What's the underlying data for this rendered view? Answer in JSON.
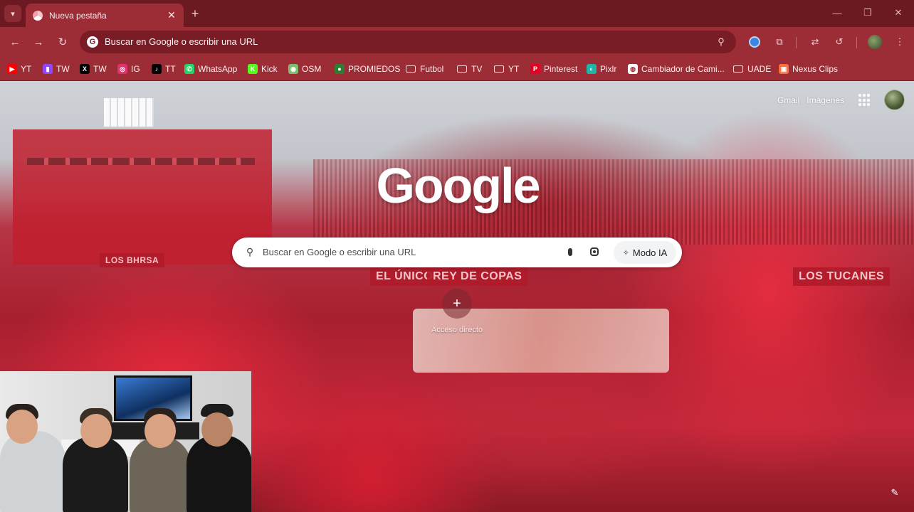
{
  "browser": {
    "tab": {
      "title": "Nueva pestaña"
    },
    "omnibox": {
      "text": "Buscar en Google o escribir una URL"
    },
    "bookmarks": [
      {
        "label": "YT",
        "icon": "youtube-icon",
        "color": "#ff0000"
      },
      {
        "label": "TW",
        "icon": "twitch-icon",
        "color": "#9146ff"
      },
      {
        "label": "TW",
        "icon": "x-icon",
        "color": "#000000"
      },
      {
        "label": "IG",
        "icon": "instagram-icon",
        "color": "#e1306c"
      },
      {
        "label": "TT",
        "icon": "tiktok-icon",
        "color": "#000000"
      },
      {
        "label": "WhatsApp",
        "icon": "whatsapp-icon",
        "color": "#25d366"
      },
      {
        "label": "Kick",
        "icon": "kick-icon",
        "color": "#53fc18"
      },
      {
        "label": "OSM",
        "icon": "osm-icon",
        "color": "#7ebc6f"
      },
      {
        "label": "PROMIEDOS",
        "icon": "promiedos-icon",
        "color": "#2e7d32"
      },
      {
        "label": "Futbol",
        "icon": "folder-icon"
      },
      {
        "label": "TV",
        "icon": "folder-icon"
      },
      {
        "label": "YT",
        "icon": "folder-icon"
      },
      {
        "label": "Pinterest",
        "icon": "pinterest-icon",
        "color": "#e60023"
      },
      {
        "label": "Pixlr",
        "icon": "pixlr-icon",
        "color": "#1fb6a8"
      },
      {
        "label": "Cambiador de Cami...",
        "icon": "globe-icon",
        "color": "#ffffff"
      },
      {
        "label": "UADE",
        "icon": "folder-icon"
      },
      {
        "label": "Nexus Clips",
        "icon": "nexus-clips-icon",
        "color": "#ff6f3c"
      }
    ]
  },
  "ntp": {
    "top_links": {
      "gmail": "Gmail",
      "images": "Imágenes"
    },
    "logo_text": "Google",
    "search": {
      "placeholder": "Buscar en Google o escribir una URL",
      "ai_mode_label": "Modo IA"
    },
    "shortcut": {
      "label": "Acceso directo",
      "plus": "+"
    },
    "banners": [
      "EL ÚNICO",
      "REY DE COPAS",
      "LOS TUCANES",
      "LOS BHRSA"
    ]
  },
  "colors": {
    "tabstrip": "#6b1a22",
    "toolbar": "#9c2c36",
    "omnibox": "#7a1c25"
  }
}
